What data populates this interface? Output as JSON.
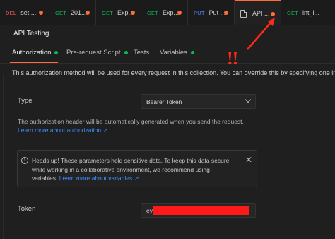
{
  "tabs": [
    {
      "method": "DEL",
      "method_color": "#ff5b5b",
      "name": "set ...",
      "dot": "#ff6c37"
    },
    {
      "method": "GET",
      "method_color": "#0cbb52",
      "name": "201...",
      "dot": "#ff6c37"
    },
    {
      "method": "GET",
      "method_color": "#0cbb52",
      "name": "Exp...",
      "dot": "#ff6c37"
    },
    {
      "method": "GET",
      "method_color": "#0cbb52",
      "name": "Exp...",
      "dot": "#ff6c37"
    },
    {
      "method": "PUT",
      "method_color": "#4d8cff",
      "name": "Put ...",
      "dot": "#ff6c37"
    },
    {
      "method": "",
      "method_color": "",
      "name": "API ...",
      "dot": "#ff6c37",
      "active": true,
      "icon": "collection-doc-icon"
    },
    {
      "method": "GET",
      "method_color": "#0cbb52",
      "name": "int_l...",
      "dot": ""
    }
  ],
  "collection_title": "API Testing",
  "subtabs": [
    {
      "label": "Authorization",
      "dot": true
    },
    {
      "label": "Pre-request Script",
      "dot": true
    },
    {
      "label": "Tests",
      "dot": false
    },
    {
      "label": "Variables",
      "dot": true
    }
  ],
  "intro_text": "This authorization method will be used for every request in this collection. You can override this by specifying one in the r",
  "type_label": "Type",
  "type_value": "Bearer Token",
  "auth_desc": "The authorization header will be automatically generated when you send the request.",
  "auth_link": "Learn more about authorization ↗",
  "banner": {
    "text": "Heads up! These parameters hold sensitive data. To keep this data secure while working in a collaborative environment, we recommend using variables.",
    "link": "Learn more about variables ↗"
  },
  "token_label": "Token",
  "token_value": "ey",
  "annotation": "!!",
  "colors": {
    "accent": "#ff6c37",
    "link": "#3b8fff",
    "annotation": "#ff2a1a",
    "redaction": "#ff1a1a"
  }
}
